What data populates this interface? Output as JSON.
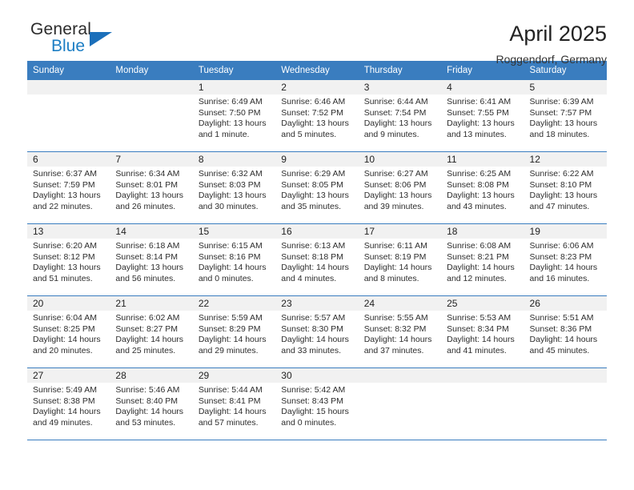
{
  "brand": {
    "name_part1": "General",
    "name_part2": "Blue",
    "triangle_color": "#1b6fba",
    "blue_color": "#1d7ec4"
  },
  "header": {
    "title": "April 2025",
    "subtitle": "Roggendorf, Germany"
  },
  "theme": {
    "header_bg": "#3a7dbf",
    "daynum_bg": "#f1f1f1",
    "row_border": "#3a7dbf",
    "text": "#2d2d2d"
  },
  "weekdays": [
    "Sunday",
    "Monday",
    "Tuesday",
    "Wednesday",
    "Thursday",
    "Friday",
    "Saturday"
  ],
  "labels": {
    "sunrise": "Sunrise:",
    "sunset": "Sunset:",
    "daylight": "Daylight:"
  },
  "weeks": [
    [
      {
        "day": "",
        "empty": true
      },
      {
        "day": "",
        "empty": true
      },
      {
        "day": "1",
        "sunrise": "Sunrise: 6:49 AM",
        "sunset": "Sunset: 7:50 PM",
        "daylight": "Daylight: 13 hours and 1 minute."
      },
      {
        "day": "2",
        "sunrise": "Sunrise: 6:46 AM",
        "sunset": "Sunset: 7:52 PM",
        "daylight": "Daylight: 13 hours and 5 minutes."
      },
      {
        "day": "3",
        "sunrise": "Sunrise: 6:44 AM",
        "sunset": "Sunset: 7:54 PM",
        "daylight": "Daylight: 13 hours and 9 minutes."
      },
      {
        "day": "4",
        "sunrise": "Sunrise: 6:41 AM",
        "sunset": "Sunset: 7:55 PM",
        "daylight": "Daylight: 13 hours and 13 minutes."
      },
      {
        "day": "5",
        "sunrise": "Sunrise: 6:39 AM",
        "sunset": "Sunset: 7:57 PM",
        "daylight": "Daylight: 13 hours and 18 minutes."
      }
    ],
    [
      {
        "day": "6",
        "sunrise": "Sunrise: 6:37 AM",
        "sunset": "Sunset: 7:59 PM",
        "daylight": "Daylight: 13 hours and 22 minutes."
      },
      {
        "day": "7",
        "sunrise": "Sunrise: 6:34 AM",
        "sunset": "Sunset: 8:01 PM",
        "daylight": "Daylight: 13 hours and 26 minutes."
      },
      {
        "day": "8",
        "sunrise": "Sunrise: 6:32 AM",
        "sunset": "Sunset: 8:03 PM",
        "daylight": "Daylight: 13 hours and 30 minutes."
      },
      {
        "day": "9",
        "sunrise": "Sunrise: 6:29 AM",
        "sunset": "Sunset: 8:05 PM",
        "daylight": "Daylight: 13 hours and 35 minutes."
      },
      {
        "day": "10",
        "sunrise": "Sunrise: 6:27 AM",
        "sunset": "Sunset: 8:06 PM",
        "daylight": "Daylight: 13 hours and 39 minutes."
      },
      {
        "day": "11",
        "sunrise": "Sunrise: 6:25 AM",
        "sunset": "Sunset: 8:08 PM",
        "daylight": "Daylight: 13 hours and 43 minutes."
      },
      {
        "day": "12",
        "sunrise": "Sunrise: 6:22 AM",
        "sunset": "Sunset: 8:10 PM",
        "daylight": "Daylight: 13 hours and 47 minutes."
      }
    ],
    [
      {
        "day": "13",
        "sunrise": "Sunrise: 6:20 AM",
        "sunset": "Sunset: 8:12 PM",
        "daylight": "Daylight: 13 hours and 51 minutes."
      },
      {
        "day": "14",
        "sunrise": "Sunrise: 6:18 AM",
        "sunset": "Sunset: 8:14 PM",
        "daylight": "Daylight: 13 hours and 56 minutes."
      },
      {
        "day": "15",
        "sunrise": "Sunrise: 6:15 AM",
        "sunset": "Sunset: 8:16 PM",
        "daylight": "Daylight: 14 hours and 0 minutes."
      },
      {
        "day": "16",
        "sunrise": "Sunrise: 6:13 AM",
        "sunset": "Sunset: 8:18 PM",
        "daylight": "Daylight: 14 hours and 4 minutes."
      },
      {
        "day": "17",
        "sunrise": "Sunrise: 6:11 AM",
        "sunset": "Sunset: 8:19 PM",
        "daylight": "Daylight: 14 hours and 8 minutes."
      },
      {
        "day": "18",
        "sunrise": "Sunrise: 6:08 AM",
        "sunset": "Sunset: 8:21 PM",
        "daylight": "Daylight: 14 hours and 12 minutes."
      },
      {
        "day": "19",
        "sunrise": "Sunrise: 6:06 AM",
        "sunset": "Sunset: 8:23 PM",
        "daylight": "Daylight: 14 hours and 16 minutes."
      }
    ],
    [
      {
        "day": "20",
        "sunrise": "Sunrise: 6:04 AM",
        "sunset": "Sunset: 8:25 PM",
        "daylight": "Daylight: 14 hours and 20 minutes."
      },
      {
        "day": "21",
        "sunrise": "Sunrise: 6:02 AM",
        "sunset": "Sunset: 8:27 PM",
        "daylight": "Daylight: 14 hours and 25 minutes."
      },
      {
        "day": "22",
        "sunrise": "Sunrise: 5:59 AM",
        "sunset": "Sunset: 8:29 PM",
        "daylight": "Daylight: 14 hours and 29 minutes."
      },
      {
        "day": "23",
        "sunrise": "Sunrise: 5:57 AM",
        "sunset": "Sunset: 8:30 PM",
        "daylight": "Daylight: 14 hours and 33 minutes."
      },
      {
        "day": "24",
        "sunrise": "Sunrise: 5:55 AM",
        "sunset": "Sunset: 8:32 PM",
        "daylight": "Daylight: 14 hours and 37 minutes."
      },
      {
        "day": "25",
        "sunrise": "Sunrise: 5:53 AM",
        "sunset": "Sunset: 8:34 PM",
        "daylight": "Daylight: 14 hours and 41 minutes."
      },
      {
        "day": "26",
        "sunrise": "Sunrise: 5:51 AM",
        "sunset": "Sunset: 8:36 PM",
        "daylight": "Daylight: 14 hours and 45 minutes."
      }
    ],
    [
      {
        "day": "27",
        "sunrise": "Sunrise: 5:49 AM",
        "sunset": "Sunset: 8:38 PM",
        "daylight": "Daylight: 14 hours and 49 minutes."
      },
      {
        "day": "28",
        "sunrise": "Sunrise: 5:46 AM",
        "sunset": "Sunset: 8:40 PM",
        "daylight": "Daylight: 14 hours and 53 minutes."
      },
      {
        "day": "29",
        "sunrise": "Sunrise: 5:44 AM",
        "sunset": "Sunset: 8:41 PM",
        "daylight": "Daylight: 14 hours and 57 minutes."
      },
      {
        "day": "30",
        "sunrise": "Sunrise: 5:42 AM",
        "sunset": "Sunset: 8:43 PM",
        "daylight": "Daylight: 15 hours and 0 minutes."
      },
      {
        "day": "",
        "empty": true
      },
      {
        "day": "",
        "empty": true
      },
      {
        "day": "",
        "empty": true
      }
    ]
  ]
}
